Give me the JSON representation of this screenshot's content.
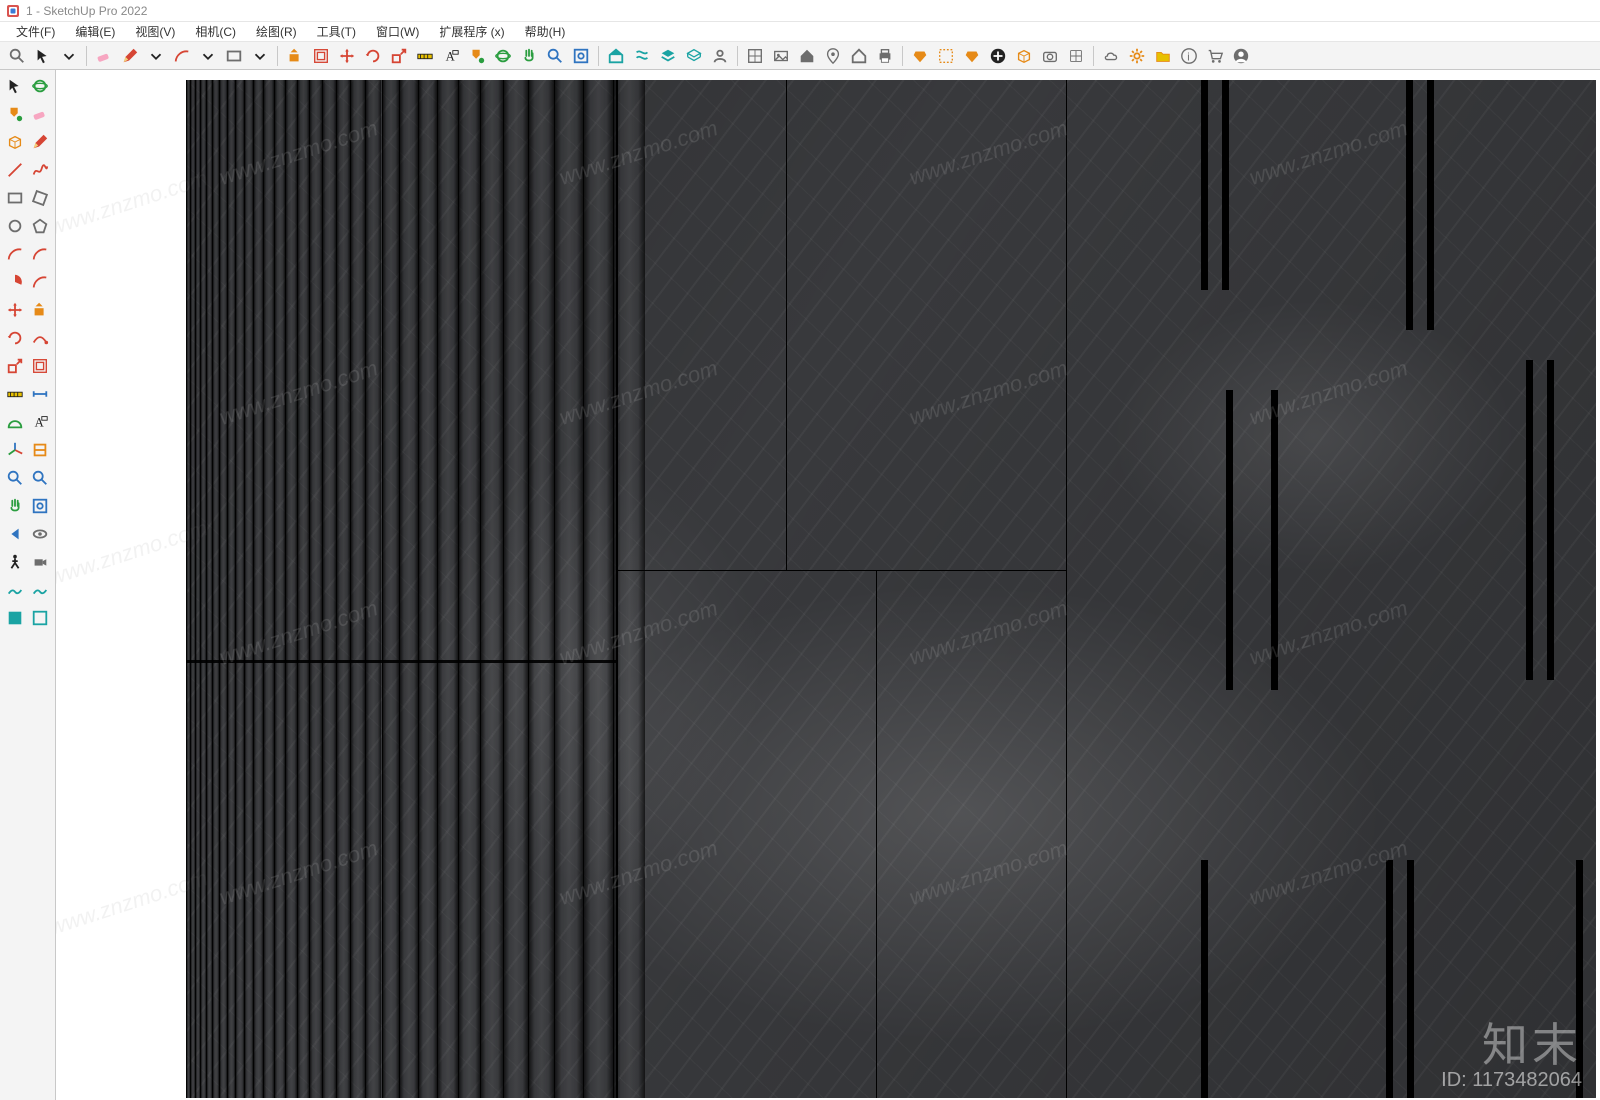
{
  "title": "1 - SketchUp Pro 2022",
  "menus": [
    "文件(F)",
    "编辑(E)",
    "视图(V)",
    "相机(C)",
    "绘图(R)",
    "工具(T)",
    "窗口(W)",
    "扩展程序 (x)",
    "帮助(H)"
  ],
  "toolbar_icons": [
    "search-icon",
    "select-icon",
    "chevron-down-icon",
    "eraser-icon",
    "pencil-icon",
    "chevron-down-icon",
    "arc-icon",
    "chevron-down-icon",
    "rectangle-icon",
    "chevron-down-icon",
    "pushpull-icon",
    "offset-icon",
    "move-icon",
    "rotate-icon",
    "scale-icon",
    "tape-icon",
    "text-icon",
    "paint-icon",
    "orbit-icon",
    "pan-icon",
    "zoom-icon",
    "zoom-extents-icon",
    "warehouse-icon",
    "extension-sep-icon",
    "layers-icon",
    "outliner-icon",
    "user-icon",
    "component-browse-icon",
    "gallery-icon",
    "home-icon",
    "location-icon",
    "home-outline-icon",
    "print-icon",
    "ruby-icon",
    "select-bounds-icon",
    "ruby2-icon",
    "add-icon",
    "box-icon",
    "camera-icon",
    "grid-icon",
    "cloud-icon",
    "gear-icon",
    "folder-icon",
    "info-icon",
    "cart-icon",
    "profile-icon"
  ],
  "left_tools": [
    "select-icon",
    "orbit-icon",
    "paint-icon",
    "eraser-icon",
    "box-icon",
    "pencil-icon",
    "line-icon",
    "freehand-icon",
    "rect-icon",
    "rot-rect-icon",
    "circle-icon",
    "polygon-icon",
    "arc-icon",
    "arc2-icon",
    "pie-icon",
    "arc3-icon",
    "move-icon",
    "pushpull-icon",
    "rotate-icon",
    "follow-icon",
    "scale-icon",
    "offset-icon",
    "tape-icon",
    "dimension-icon",
    "protractor-icon",
    "text-icon",
    "axes-icon",
    "section-icon",
    "zoom-icon",
    "zoom-icon",
    "pan-icon",
    "zoom-extents-icon",
    "prev-icon",
    "look-icon",
    "walk-icon",
    "position-cam-icon",
    "sandbox-icon",
    "sandbox2-icon",
    "style1-icon",
    "style2-icon"
  ],
  "watermark_text": "www.znzmo.com",
  "watermark_brand": "知末",
  "watermark_id": "ID: 1173482064"
}
